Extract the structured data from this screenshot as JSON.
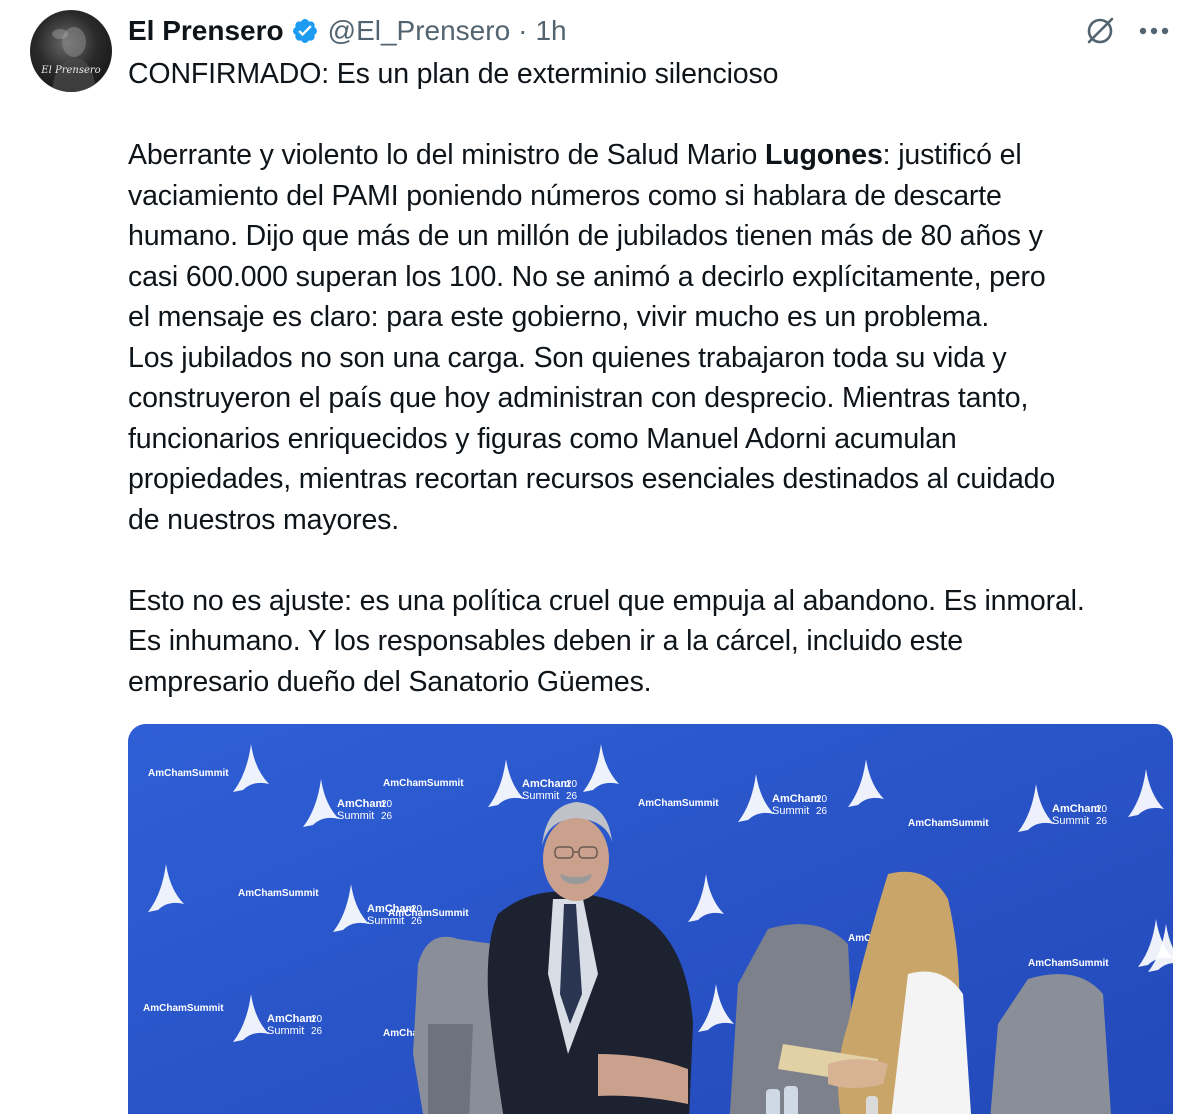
{
  "author": {
    "display_name": "El Prensero",
    "handle": "@El_Prensero",
    "separator": "·",
    "time": "1h",
    "avatar_caption": "El Prensero",
    "verified_color": "#1d9bf0"
  },
  "actions": {
    "grok_icon": "slashed-circle-icon",
    "more_icon": "more-dots-icon"
  },
  "tweet": {
    "headline": "CONFIRMADO: Es un plan de exterminio silencioso",
    "p2_line1_pre": "Aberrante y violento lo del ministro de Salud Mario ",
    "p2_line1_bold": "Lugones",
    "p2_line1_post": ": justificó el",
    "p2_line2": "vaciamiento del PAMI poniendo números como si hablara de descarte",
    "p2_line3": "humano. Dijo que más de un millón de jubilados tienen más de 80 años y",
    "p2_line4": "casi 600.000 superan los 100. No se animó a decirlo explícitamente, pero",
    "p2_line5": "el mensaje es claro: para este gobierno, vivir mucho es un problema.",
    "p2_line6": "Los jubilados no son una carga. Son quienes trabajaron toda su vida y",
    "p2_line7": "construyeron el país que hoy administran con desprecio. Mientras tanto,",
    "p2_line8": "funcionarios enriquecidos y figuras como Manuel Adorni acumulan",
    "p2_line9": "propiedades, mientras recortan recursos esenciales destinados al cuidado",
    "p2_line10": "de nuestros mayores.",
    "p3_line1": "Esto no es ajuste: es una política cruel que empuja al abandono. Es inmoral.",
    "p3_line2": "Es inhumano. Y los responsables deben ir a la cárcel, incluido este",
    "p3_line3": "empresario dueño del Sanatorio Güemes."
  },
  "media": {
    "backdrop_text_a": "AmCham",
    "backdrop_text_b": "Summit",
    "backdrop_year_a": "20",
    "backdrop_year_b": "26",
    "backdrop_brand": "AmChamSummit",
    "backdrop_color": "#2a55c8"
  }
}
